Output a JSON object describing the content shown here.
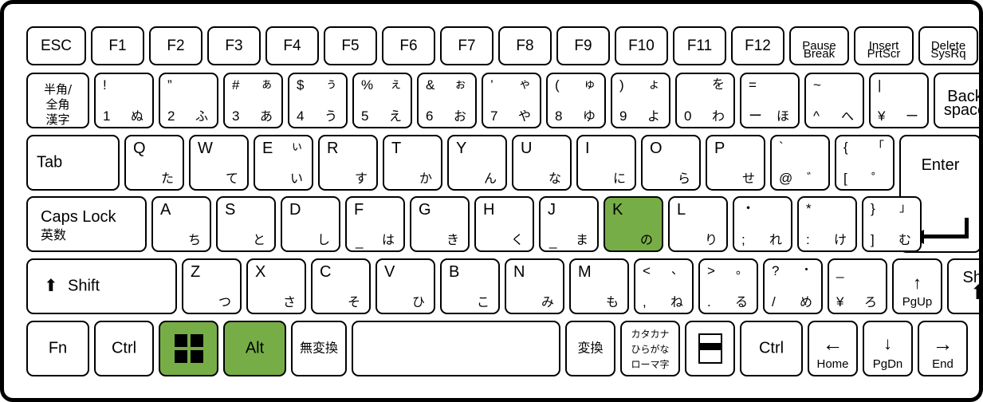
{
  "keyboard": {
    "layout_name": "Japanese JIS keyboard",
    "highlight_color": "#77ad47",
    "base_color": "#ffffff",
    "outline_color": "#000000",
    "highlighted_keys": [
      "K",
      "Win",
      "Alt"
    ],
    "rows": [
      {
        "name": "function-row",
        "keys": [
          {
            "name": "esc",
            "center": "ESC"
          },
          {
            "name": "f1",
            "center": "F1"
          },
          {
            "name": "f2",
            "center": "F2"
          },
          {
            "name": "f3",
            "center": "F3"
          },
          {
            "name": "f4",
            "center": "F4"
          },
          {
            "name": "f5",
            "center": "F5"
          },
          {
            "name": "f6",
            "center": "F6"
          },
          {
            "name": "f7",
            "center": "F7"
          },
          {
            "name": "f8",
            "center": "F8"
          },
          {
            "name": "f9",
            "center": "F9"
          },
          {
            "name": "f10",
            "center": "F10"
          },
          {
            "name": "f11",
            "center": "F11"
          },
          {
            "name": "f12",
            "center": "F12"
          },
          {
            "name": "pause-break",
            "top": "Pause",
            "bottom": "Break"
          },
          {
            "name": "insert-prtscr",
            "top": "Insert",
            "bottom": "PrtScr"
          },
          {
            "name": "delete-sysrq",
            "top": "Delete",
            "bottom": "SysRq"
          }
        ]
      },
      {
        "name": "number-row",
        "keys": [
          {
            "name": "hankaku-zenkaku",
            "lines": [
              "半角/",
              "全角",
              "漢字"
            ]
          },
          {
            "name": "digit-1",
            "tl": "!",
            "tr": "",
            "bl": "1",
            "br": "ぬ"
          },
          {
            "name": "digit-2",
            "tl": "”",
            "tr": "",
            "bl": "2",
            "br": "ふ"
          },
          {
            "name": "digit-3",
            "tl": "#",
            "tr": "ぁ",
            "bl": "3",
            "br": "あ"
          },
          {
            "name": "digit-4",
            "tl": "$",
            "tr": "ぅ",
            "bl": "4",
            "br": "う"
          },
          {
            "name": "digit-5",
            "tl": "%",
            "tr": "ぇ",
            "bl": "5",
            "br": "え"
          },
          {
            "name": "digit-6",
            "tl": "&",
            "tr": "ぉ",
            "bl": "6",
            "br": "お"
          },
          {
            "name": "digit-7",
            "tl": "’",
            "tr": "ゃ",
            "bl": "7",
            "br": "や"
          },
          {
            "name": "digit-8",
            "tl": "(",
            "tr": "ゅ",
            "bl": "8",
            "br": "ゆ"
          },
          {
            "name": "digit-9",
            "tl": ")",
            "tr": "ょ",
            "bl": "9",
            "br": "よ"
          },
          {
            "name": "digit-0",
            "tl": "",
            "tr": "を",
            "bl": "0",
            "br": "わ"
          },
          {
            "name": "minus",
            "tl": "=",
            "tr": "",
            "bl": "ー",
            "br": "ほ"
          },
          {
            "name": "caret",
            "tl": "~",
            "tr": "",
            "bl": "^",
            "br": "へ"
          },
          {
            "name": "yen",
            "tl": "|",
            "tr": "",
            "bl": "¥",
            "br": "ー"
          },
          {
            "name": "backspace",
            "top": "Back",
            "bottom": "space"
          }
        ]
      },
      {
        "name": "top-letter-row",
        "keys": [
          {
            "name": "tab",
            "label": "Tab"
          },
          {
            "name": "q",
            "tl": "Q",
            "br": "た"
          },
          {
            "name": "w",
            "tl": "W",
            "br": "て"
          },
          {
            "name": "e",
            "tl": "E",
            "tr": "ぃ",
            "br": "い"
          },
          {
            "name": "r",
            "tl": "R",
            "br": "す"
          },
          {
            "name": "t",
            "tl": "T",
            "br": "か"
          },
          {
            "name": "y",
            "tl": "Y",
            "br": "ん"
          },
          {
            "name": "u",
            "tl": "U",
            "br": "な"
          },
          {
            "name": "i",
            "tl": "I",
            "br": "に"
          },
          {
            "name": "o",
            "tl": "O",
            "br": "ら"
          },
          {
            "name": "p",
            "tl": "P",
            "br": "せ"
          },
          {
            "name": "at",
            "tl": "`",
            "bl": "@",
            "br": "゛"
          },
          {
            "name": "bracket-left",
            "tl": "{",
            "tr": "「",
            "bl": "[",
            "br": "゜"
          },
          {
            "name": "enter",
            "label": "Enter"
          }
        ]
      },
      {
        "name": "home-row",
        "keys": [
          {
            "name": "caps-lock",
            "top": "Caps Lock",
            "bottom": "英数"
          },
          {
            "name": "a",
            "tl": "A",
            "br": "ち"
          },
          {
            "name": "s",
            "tl": "S",
            "br": "と"
          },
          {
            "name": "d",
            "tl": "D",
            "br": "し"
          },
          {
            "name": "f",
            "tl": "F",
            "bl": "_",
            "br": "は"
          },
          {
            "name": "g",
            "tl": "G",
            "br": "き"
          },
          {
            "name": "h",
            "tl": "H",
            "br": "く"
          },
          {
            "name": "j",
            "tl": "J",
            "bl": "_",
            "br": "ま"
          },
          {
            "name": "k",
            "tl": "K",
            "br": "の",
            "highlight": true
          },
          {
            "name": "l",
            "tl": "L",
            "br": "り"
          },
          {
            "name": "semicolon",
            "tl": "・",
            "bl": ";",
            "br": "れ"
          },
          {
            "name": "colon",
            "tl": "*",
            "bl": ":",
            "br": "け"
          },
          {
            "name": "bracket-right",
            "tl": "}",
            "tr": "」",
            "bl": "]",
            "br": "む"
          }
        ]
      },
      {
        "name": "bottom-letter-row",
        "keys": [
          {
            "name": "shift-left",
            "label": "Shift",
            "icon": "shift-up-arrow-icon"
          },
          {
            "name": "z",
            "tl": "Z",
            "br": "つ"
          },
          {
            "name": "x",
            "tl": "X",
            "br": "さ"
          },
          {
            "name": "c",
            "tl": "C",
            "br": "そ"
          },
          {
            "name": "v",
            "tl": "V",
            "br": "ひ"
          },
          {
            "name": "b",
            "tl": "B",
            "br": "こ"
          },
          {
            "name": "n",
            "tl": "N",
            "br": "み"
          },
          {
            "name": "m",
            "tl": "M",
            "br": "も"
          },
          {
            "name": "comma",
            "tl": "<",
            "tr": "、",
            "bl": ",",
            "br": "ね"
          },
          {
            "name": "period",
            "tl": ">",
            "tr": "。",
            "bl": ".",
            "br": "る"
          },
          {
            "name": "slash",
            "tl": "?",
            "tr": "・",
            "bl": "/",
            "br": "め"
          },
          {
            "name": "backslash-ro",
            "tl": "_",
            "bl": "¥",
            "br": "ろ"
          },
          {
            "name": "up-pgup",
            "arrow": "↑",
            "bottom": "PgUp"
          },
          {
            "name": "shift-right",
            "label": "Shift",
            "icon": "shift-up-arrow-icon"
          }
        ]
      },
      {
        "name": "modifier-row",
        "keys": [
          {
            "name": "fn",
            "center": "Fn"
          },
          {
            "name": "ctrl-left",
            "center": "Ctrl"
          },
          {
            "name": "windows",
            "icon": "windows-logo-icon",
            "highlight": true
          },
          {
            "name": "alt-left",
            "center": "Alt",
            "highlight": true
          },
          {
            "name": "muhenkan",
            "center": "無変換"
          },
          {
            "name": "space",
            "center": ""
          },
          {
            "name": "henkan",
            "center": "変換"
          },
          {
            "name": "katakana-hiragana",
            "lines": [
              "カタカナ",
              "ひらがな",
              "ローマ字"
            ]
          },
          {
            "name": "menu",
            "icon": "menu-list-icon"
          },
          {
            "name": "ctrl-right",
            "center": "Ctrl"
          },
          {
            "name": "left-home",
            "arrow": "←",
            "bottom": "Home"
          },
          {
            "name": "down-pgdn",
            "arrow": "↓",
            "bottom": "PgDn"
          },
          {
            "name": "right-end",
            "arrow": "→",
            "bottom": "End"
          }
        ]
      }
    ]
  }
}
